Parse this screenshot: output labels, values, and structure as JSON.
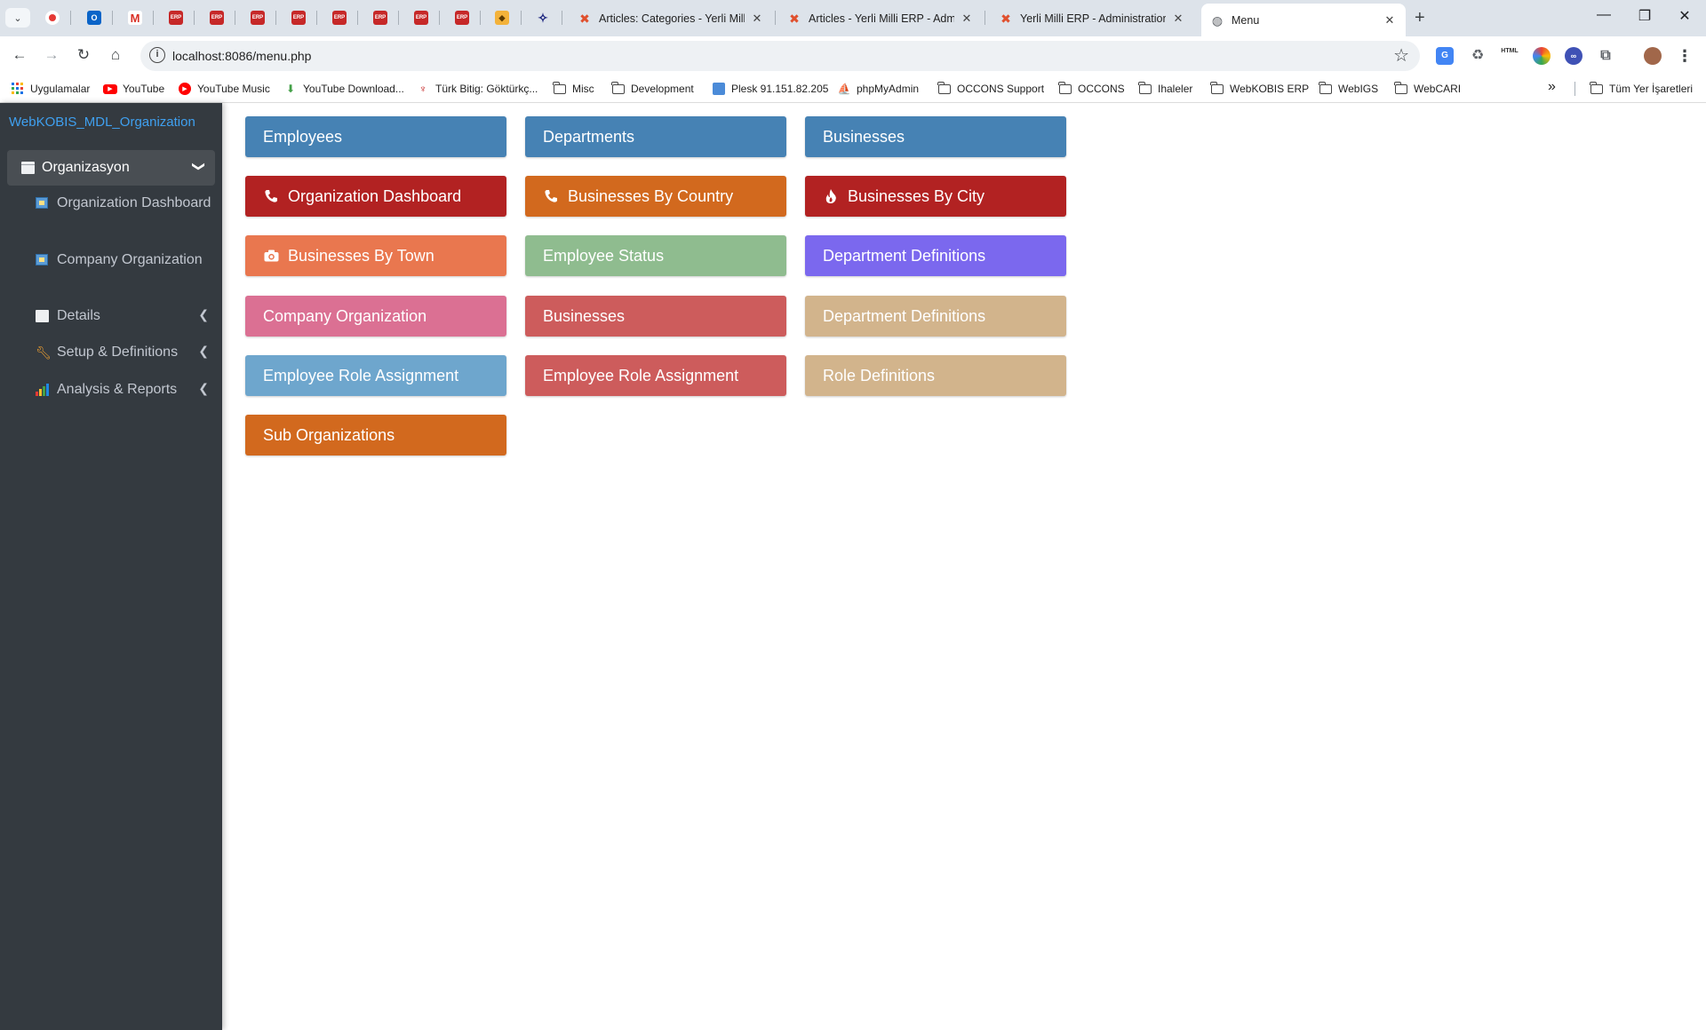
{
  "browser": {
    "tabs": [
      {
        "title": "Articles: Categories - Yerli Milli ERP - Administration",
        "close": "✕"
      },
      {
        "title": "Articles - Yerli Milli ERP - Administration",
        "close": "✕"
      },
      {
        "title": "Yerli Milli ERP - Administration",
        "close": "✕"
      },
      {
        "title": "Menu",
        "close": "✕"
      }
    ],
    "new_tab": "+",
    "url": "localhost:8086/menu.php",
    "window_controls": {
      "minimize": "—",
      "restore": "❐",
      "close": "✕"
    }
  },
  "bookmarks": [
    {
      "label": "Uygulamalar",
      "icon": "apps-grid-icon"
    },
    {
      "label": "YouTube",
      "icon": "youtube-icon"
    },
    {
      "label": "YouTube Music",
      "icon": "youtube-music-icon"
    },
    {
      "label": "YouTube Download...",
      "icon": "download-arrow-icon"
    },
    {
      "label": "Türk Bitig: Göktürkç...",
      "icon": "turk-bitig-icon"
    },
    {
      "label": "Misc",
      "icon": "folder-icon"
    },
    {
      "label": "Development",
      "icon": "folder-icon"
    },
    {
      "label": "Plesk 91.151.82.205",
      "icon": "plesk-icon"
    },
    {
      "label": "phpMyAdmin",
      "icon": "phpmyadmin-icon"
    },
    {
      "label": "OCCONS Support",
      "icon": "folder-icon"
    },
    {
      "label": "OCCONS",
      "icon": "folder-icon"
    },
    {
      "label": "Ihaleler",
      "icon": "folder-icon"
    },
    {
      "label": "WebKOBIS ERP",
      "icon": "folder-icon"
    },
    {
      "label": "WebIGS",
      "icon": "folder-icon"
    },
    {
      "label": "WebCARI",
      "icon": "folder-icon"
    }
  ],
  "bookmarks_overflow": "»",
  "bookmarks_all": "Tüm Yer İşaretleri",
  "sidebar": {
    "brand": "WebKOBIS_MDL_Organization",
    "group": {
      "label": "Organizasyon",
      "expanded": true
    },
    "sub_items": [
      {
        "label": "Organization Dashboard"
      },
      {
        "label": "Company Organization"
      }
    ],
    "nav_items": [
      {
        "label": "Details",
        "icon": "calendar-icon"
      },
      {
        "label": "Setup & Definitions",
        "icon": "wrench-icon"
      },
      {
        "label": "Analysis & Reports",
        "icon": "bar-chart-icon"
      }
    ]
  },
  "tiles": [
    {
      "label": "Employees",
      "color": "#4682b4",
      "icon": ""
    },
    {
      "label": "Departments",
      "color": "#4682b4",
      "icon": ""
    },
    {
      "label": "Businesses",
      "color": "#4682b4",
      "icon": ""
    },
    {
      "label": "Organization Dashboard",
      "color": "#b22222",
      "icon": "phone-icon"
    },
    {
      "label": "Businesses By Country",
      "color": "#d2691e",
      "icon": "phone-icon"
    },
    {
      "label": "Businesses By City",
      "color": "#b22222",
      "icon": "fire-icon"
    },
    {
      "label": "Businesses By Town",
      "color": "#e9774f",
      "icon": "camera-icon"
    },
    {
      "label": "Employee Status",
      "color": "#8fbc8f",
      "icon": ""
    },
    {
      "label": "Department Definitions",
      "color": "#7b68ee",
      "icon": ""
    },
    {
      "label": "Company Organization",
      "color": "#db7093",
      "icon": ""
    },
    {
      "label": "Businesses",
      "color": "#cd5c5c",
      "icon": ""
    },
    {
      "label": "Department Definitions",
      "color": "#d2b48c",
      "icon": ""
    },
    {
      "label": "Employee Role Assignment",
      "color": "#6ea6cd",
      "icon": ""
    },
    {
      "label": "Employee Role Assignment",
      "color": "#cd5c5c",
      "icon": ""
    },
    {
      "label": "Role Definitions",
      "color": "#d2b48c",
      "icon": ""
    },
    {
      "label": "Sub Organizations",
      "color": "#d2691e",
      "icon": ""
    }
  ]
}
